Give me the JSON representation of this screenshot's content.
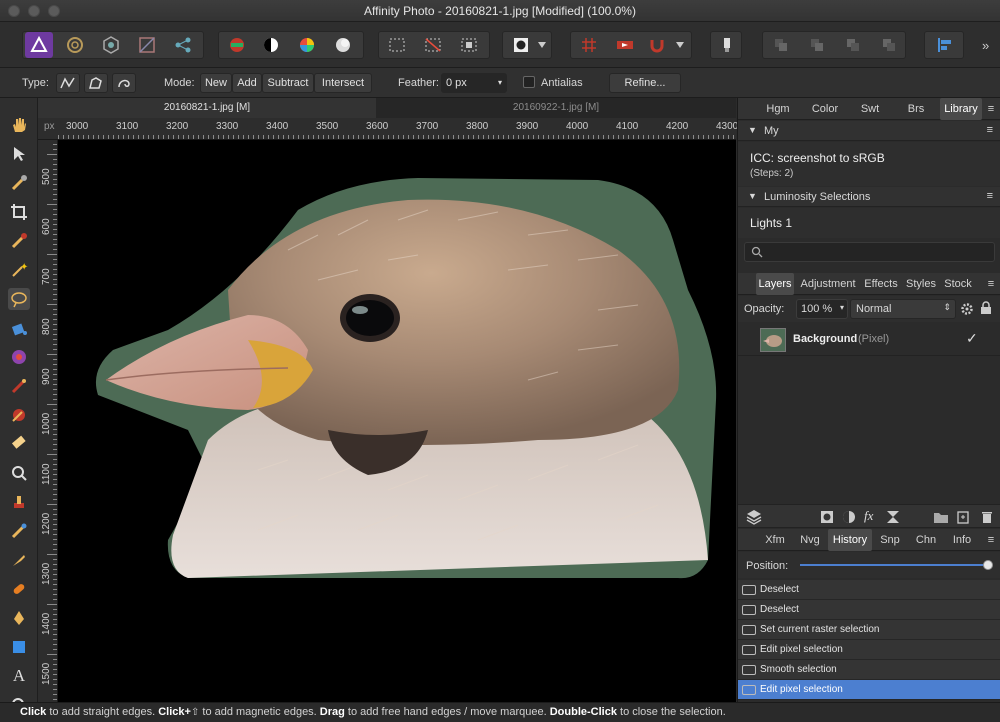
{
  "window": {
    "title": "Affinity Photo - 20160821-1.jpg [Modified] (100.0%)"
  },
  "toolbar": {
    "personas": [
      "photo-persona-icon",
      "liquify-persona-icon",
      "develop-persona-icon",
      "tone-mapping-persona-icon",
      "export-persona-icon"
    ],
    "colors": {
      "accent": "#8e44ad"
    }
  },
  "contextbar": {
    "type_label": "Type:",
    "mode_label": "Mode:",
    "mode_options": [
      "New",
      "Add",
      "Subtract",
      "Intersect"
    ],
    "feather_label": "Feather:",
    "feather_value": "0 px",
    "antialias_label": "Antialias",
    "refine_label": "Refine..."
  },
  "doctabs": [
    "20160821-1.jpg [M]",
    "20160922-1.jpg [M]"
  ],
  "ruler": {
    "unit": "px",
    "h_labels": [
      "3000",
      "3100",
      "3200",
      "3300",
      "3400",
      "3500",
      "3600",
      "3700",
      "3800",
      "3900",
      "4000",
      "4100",
      "4200",
      "4300"
    ],
    "v_labels": [
      "500",
      "600",
      "700",
      "800",
      "900",
      "1000",
      "1100",
      "1200",
      "1300",
      "1400",
      "1500"
    ]
  },
  "library_panel": {
    "tabs": [
      "Hgm",
      "Color",
      "Swt",
      "Brs",
      "Library"
    ],
    "active_tab": "Library",
    "group1": "My",
    "item1_title": "ICC: screenshot to sRGB",
    "item1_steps": "(Steps: 2)",
    "group2": "Luminosity Selections",
    "item2_title": "Lights 1",
    "search_placeholder": ""
  },
  "layers_panel": {
    "tabs": [
      "Layers",
      "Adjustment",
      "Effects",
      "Styles",
      "Stock"
    ],
    "active_tab": "Layers",
    "opacity_label": "Opacity:",
    "opacity_value": "100 %",
    "blend_mode": "Normal",
    "layer_name": "Background",
    "layer_type": "(Pixel)"
  },
  "history_panel": {
    "tabs": [
      "Xfm",
      "Nvg",
      "History",
      "Snp",
      "Chn",
      "Info"
    ],
    "active_tab": "History",
    "position_label": "Position:",
    "position_fraction": 1.0,
    "items": [
      "Deselect",
      "Deselect",
      "Set current raster selection",
      "Edit pixel selection",
      "Smooth selection",
      "Edit pixel selection"
    ],
    "selected_index": 5
  },
  "status": {
    "s1": "Click",
    "t1": " to add straight edges. ",
    "s2": "Click+",
    "t2": " to add magnetic edges. ",
    "s3": "Drag",
    "t3": " to add free hand edges / move marquee. ",
    "s4": "Double-Click",
    "t4": " to close the selection."
  }
}
